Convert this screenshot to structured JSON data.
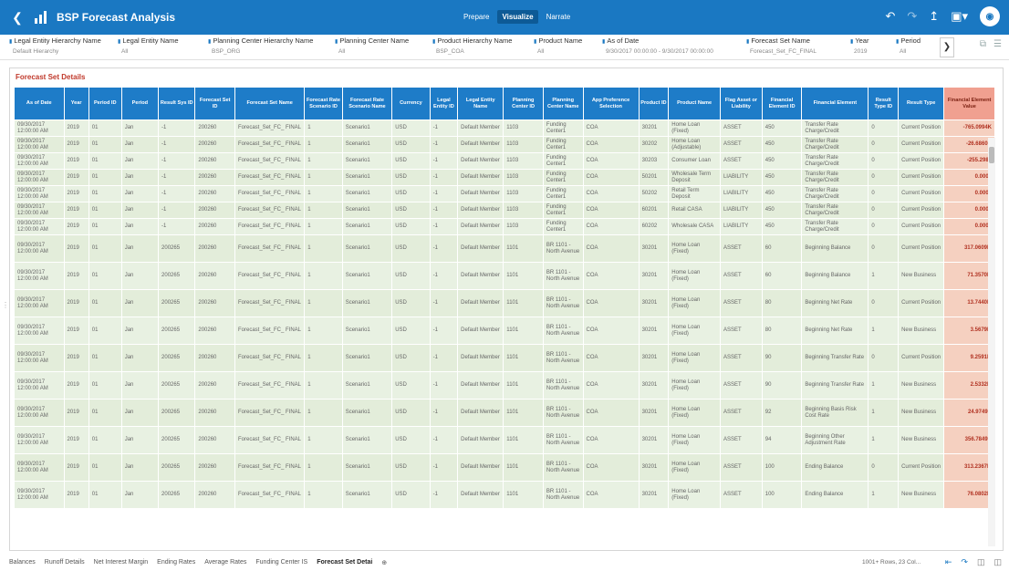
{
  "app": {
    "title": "BSP Forecast Analysis",
    "modes": [
      "Prepare",
      "Visualize",
      "Narrate"
    ],
    "active_mode": "Visualize",
    "avatar_initial": "◉"
  },
  "filters": [
    {
      "label": "Legal Entity Hierarchy Name",
      "value": "Default Hierarchy"
    },
    {
      "label": "Legal Entity Name",
      "value": "All"
    },
    {
      "label": "Planning Center Hierarchy Name",
      "value": "BSP_ORG"
    },
    {
      "label": "Planning Center Name",
      "value": "All"
    },
    {
      "label": "Product Hierarchy Name",
      "value": "BSP_COA"
    },
    {
      "label": "Product Name",
      "value": "All"
    },
    {
      "label": "As of Date",
      "value": "9/30/2017 00:00:00 - 9/30/2017 00:00:00"
    },
    {
      "label": "Forecast Set Name",
      "value": "Forecast_Set_FC_FINAL"
    },
    {
      "label": "Year",
      "value": "2019"
    },
    {
      "label": "Period",
      "value": "All"
    }
  ],
  "panel": {
    "title": "Forecast Set Details"
  },
  "columns": [
    "As of Date",
    "Year",
    "Period ID",
    "Period",
    "Result Sys ID",
    "Forecast Set ID",
    "Forecast Set Name",
    "Forecast Rate Scenario ID",
    "Forecast Rate Scenario Name",
    "Currency",
    "Legal Entity ID",
    "Legal Entity Name",
    "Planning Center ID",
    "Planning Center Name",
    "App Preference Selection",
    "Product ID",
    "Product Name",
    "Flag Asset or Liability",
    "Financial Element ID",
    "Financial Element",
    "Result Type ID",
    "Result Type",
    "Financial Element Value"
  ],
  "rows": [
    [
      "09/30/2017 12:00:00 AM",
      "2019",
      "01",
      "Jan",
      "-1",
      "200260",
      "Forecast_Set_FC_ FINAL",
      "1",
      "Scenario1",
      "USD",
      "-1",
      "Default Member",
      "1103",
      "Funding Center1",
      "COA",
      "30201",
      "Home Loan (Fixed)",
      "ASSET",
      "450",
      "Transfer Rate Charge/Credit",
      "0",
      "Current Position",
      "-765.0994K"
    ],
    [
      "09/30/2017 12:00:00 AM",
      "2019",
      "01",
      "Jan",
      "-1",
      "200260",
      "Forecast_Set_FC_ FINAL",
      "1",
      "Scenario1",
      "USD",
      "-1",
      "Default Member",
      "1103",
      "Funding Center1",
      "COA",
      "30202",
      "Home Loan (Adjustable)",
      "ASSET",
      "450",
      "Transfer Rate Charge/Credit",
      "0",
      "Current Position",
      "-26.6860K"
    ],
    [
      "09/30/2017 12:00:00 AM",
      "2019",
      "01",
      "Jan",
      "-1",
      "200260",
      "Forecast_Set_FC_ FINAL",
      "1",
      "Scenario1",
      "USD",
      "-1",
      "Default Member",
      "1103",
      "Funding Center1",
      "COA",
      "30203",
      "Consumer Loan",
      "ASSET",
      "450",
      "Transfer Rate Charge/Credit",
      "0",
      "Current Position",
      "-255.2980"
    ],
    [
      "09/30/2017 12:00:00 AM",
      "2019",
      "01",
      "Jan",
      "-1",
      "200260",
      "Forecast_Set_FC_ FINAL",
      "1",
      "Scenario1",
      "USD",
      "-1",
      "Default Member",
      "1103",
      "Funding Center1",
      "COA",
      "50201",
      "Wholesale Term Deposit",
      "LIABILITY",
      "450",
      "Transfer Rate Charge/Credit",
      "0",
      "Current Position",
      "0.0000"
    ],
    [
      "09/30/2017 12:00:00 AM",
      "2019",
      "01",
      "Jan",
      "-1",
      "200260",
      "Forecast_Set_FC_ FINAL",
      "1",
      "Scenario1",
      "USD",
      "-1",
      "Default Member",
      "1103",
      "Funding Center1",
      "COA",
      "50202",
      "Retail Term Deposit",
      "LIABILITY",
      "450",
      "Transfer Rate Charge/Credit",
      "0",
      "Current Position",
      "0.0000"
    ],
    [
      "09/30/2017 12:00:00 AM",
      "2019",
      "01",
      "Jan",
      "-1",
      "200260",
      "Forecast_Set_FC_ FINAL",
      "1",
      "Scenario1",
      "USD",
      "-1",
      "Default Member",
      "1103",
      "Funding Center1",
      "COA",
      "60201",
      "Retail CASA",
      "LIABILITY",
      "450",
      "Transfer Rate Charge/Credit",
      "0",
      "Current Position",
      "0.0000"
    ],
    [
      "09/30/2017 12:00:00 AM",
      "2019",
      "01",
      "Jan",
      "-1",
      "200260",
      "Forecast_Set_FC_ FINAL",
      "1",
      "Scenario1",
      "USD",
      "-1",
      "Default Member",
      "1103",
      "Funding Center1",
      "COA",
      "60202",
      "Wholesale CASA",
      "LIABILITY",
      "450",
      "Transfer Rate Charge/Credit",
      "0",
      "Current Position",
      "0.0000"
    ],
    [
      "09/30/2017 12:00:00 AM",
      "2019",
      "01",
      "Jan",
      "200265",
      "200260",
      "Forecast_Set_FC_ FINAL",
      "1",
      "Scenario1",
      "USD",
      "-1",
      "Default Member",
      "1101",
      "BR 1101 - North Avenue",
      "COA",
      "30201",
      "Home Loan (Fixed)",
      "ASSET",
      "60",
      "Beginning Balance",
      "0",
      "Current Position",
      "317.0609M"
    ],
    [
      "09/30/2017 12:00:00 AM",
      "2019",
      "01",
      "Jan",
      "200265",
      "200260",
      "Forecast_Set_FC_ FINAL",
      "1",
      "Scenario1",
      "USD",
      "-1",
      "Default Member",
      "1101",
      "BR 1101 - North Avenue",
      "COA",
      "30201",
      "Home Loan (Fixed)",
      "ASSET",
      "60",
      "Beginning Balance",
      "1",
      "New Business",
      "71.3570M"
    ],
    [
      "09/30/2017 12:00:00 AM",
      "2019",
      "01",
      "Jan",
      "200265",
      "200260",
      "Forecast_Set_FC_ FINAL",
      "1",
      "Scenario1",
      "USD",
      "-1",
      "Default Member",
      "1101",
      "BR 1101 - North Avenue",
      "COA",
      "30201",
      "Home Loan (Fixed)",
      "ASSET",
      "80",
      "Beginning Net Rate",
      "0",
      "Current Position",
      "13.7440M"
    ],
    [
      "09/30/2017 12:00:00 AM",
      "2019",
      "01",
      "Jan",
      "200265",
      "200260",
      "Forecast_Set_FC_ FINAL",
      "1",
      "Scenario1",
      "USD",
      "-1",
      "Default Member",
      "1101",
      "BR 1101 - North Avenue",
      "COA",
      "30201",
      "Home Loan (Fixed)",
      "ASSET",
      "80",
      "Beginning Net Rate",
      "1",
      "New Business",
      "3.5679M"
    ],
    [
      "09/30/2017 12:00:00 AM",
      "2019",
      "01",
      "Jan",
      "200265",
      "200260",
      "Forecast_Set_FC_ FINAL",
      "1",
      "Scenario1",
      "USD",
      "-1",
      "Default Member",
      "1101",
      "BR 1101 - North Avenue",
      "COA",
      "30201",
      "Home Loan (Fixed)",
      "ASSET",
      "90",
      "Beginning Transfer Rate",
      "0",
      "Current Position",
      "9.2591M"
    ],
    [
      "09/30/2017 12:00:00 AM",
      "2019",
      "01",
      "Jan",
      "200265",
      "200260",
      "Forecast_Set_FC_ FINAL",
      "1",
      "Scenario1",
      "USD",
      "-1",
      "Default Member",
      "1101",
      "BR 1101 - North Avenue",
      "COA",
      "30201",
      "Home Loan (Fixed)",
      "ASSET",
      "90",
      "Beginning Transfer Rate",
      "1",
      "New Business",
      "2.5332M"
    ],
    [
      "09/30/2017 12:00:00 AM",
      "2019",
      "01",
      "Jan",
      "200265",
      "200260",
      "Forecast_Set_FC_ FINAL",
      "1",
      "Scenario1",
      "USD",
      "-1",
      "Default Member",
      "1101",
      "BR 1101 - North Avenue",
      "COA",
      "30201",
      "Home Loan (Fixed)",
      "ASSET",
      "92",
      "Beginning Basis Risk Cost Rate",
      "1",
      "New Business",
      "24.9749K"
    ],
    [
      "09/30/2017 12:00:00 AM",
      "2019",
      "01",
      "Jan",
      "200265",
      "200260",
      "Forecast_Set_FC_ FINAL",
      "1",
      "Scenario1",
      "USD",
      "-1",
      "Default Member",
      "1101",
      "BR 1101 - North Avenue",
      "COA",
      "30201",
      "Home Loan (Fixed)",
      "ASSET",
      "94",
      "Beginning Other Adjustment Rate",
      "1",
      "New Business",
      "356.7849K"
    ],
    [
      "09/30/2017 12:00:00 AM",
      "2019",
      "01",
      "Jan",
      "200265",
      "200260",
      "Forecast_Set_FC_ FINAL",
      "1",
      "Scenario1",
      "USD",
      "-1",
      "Default Member",
      "1101",
      "BR 1101 - North Avenue",
      "COA",
      "30201",
      "Home Loan (Fixed)",
      "ASSET",
      "100",
      "Ending Balance",
      "0",
      "Current Position",
      "313.2367M"
    ],
    [
      "09/30/2017 12:00:00 AM",
      "2019",
      "01",
      "Jan",
      "200265",
      "200260",
      "Forecast_Set_FC_ FINAL",
      "1",
      "Scenario1",
      "USD",
      "-1",
      "Default Member",
      "1101",
      "BR 1101 - North Avenue",
      "COA",
      "30201",
      "Home Loan (Fixed)",
      "ASSET",
      "100",
      "Ending Balance",
      "1",
      "New Business",
      "76.0802M"
    ]
  ],
  "tabs": [
    "Balances",
    "Runoff Details",
    "Net Interest Margin",
    "Ending Rates",
    "Average Rates",
    "Funding Center IS",
    "Forecast Set Detai"
  ],
  "active_tab": "Forecast Set Detai",
  "row_count": "1001+ Rows, 23 Col..."
}
